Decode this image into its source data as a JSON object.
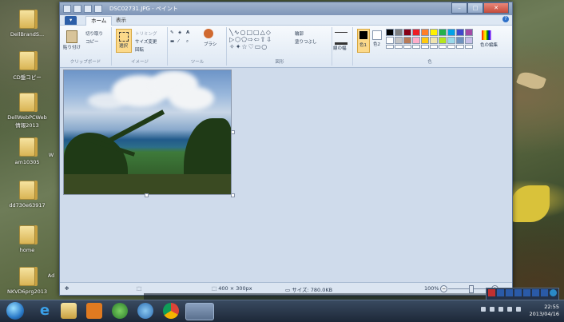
{
  "window": {
    "title": "DSC02731.JPG - ペイント"
  },
  "tabs": {
    "file": "▾",
    "home": "ホーム",
    "view": "表示"
  },
  "ribbon": {
    "clipboard": {
      "paste": "貼り付け",
      "cut": "切り取り",
      "copy": "コピー",
      "group": "クリップボード"
    },
    "image": {
      "select": "選択",
      "crop": "トリミング",
      "resize": "サイズ変更",
      "rotate": "回転",
      "group": "イメージ"
    },
    "tools": {
      "brush": "ブラシ",
      "group": "ツール"
    },
    "shapes": {
      "outline": "輪郭",
      "fill": "塗りつぶし",
      "group": "図形"
    },
    "size": {
      "label": "線の幅"
    },
    "colors": {
      "color1": "色1",
      "color2": "色2",
      "edit": "色の編集",
      "group": "色"
    }
  },
  "palette": [
    "#000000",
    "#7f7f7f",
    "#880015",
    "#ed1c24",
    "#ff7f27",
    "#fff200",
    "#22b14c",
    "#00a2e8",
    "#3f48cc",
    "#a349a4",
    "#ffffff",
    "#c3c3c3",
    "#b97a57",
    "#ffaec9",
    "#ffc90e",
    "#efe4b0",
    "#b5e61d",
    "#99d9ea",
    "#7092be",
    "#c8bfe7"
  ],
  "status": {
    "dims": "400 × 300px",
    "size": "サイズ: 780.0KB",
    "zoom": "100%"
  },
  "desktop": [
    "DellBrandS...",
    "CD盤コピー",
    "DellWebPCWeb\n情報2013",
    "am10305",
    "dd730e63917",
    "home",
    "NKVD6prg2013"
  ],
  "desktop_extra": [
    "Ad",
    "W"
  ],
  "taskbar": {
    "time": "22:55",
    "date": "2013/04/16"
  }
}
